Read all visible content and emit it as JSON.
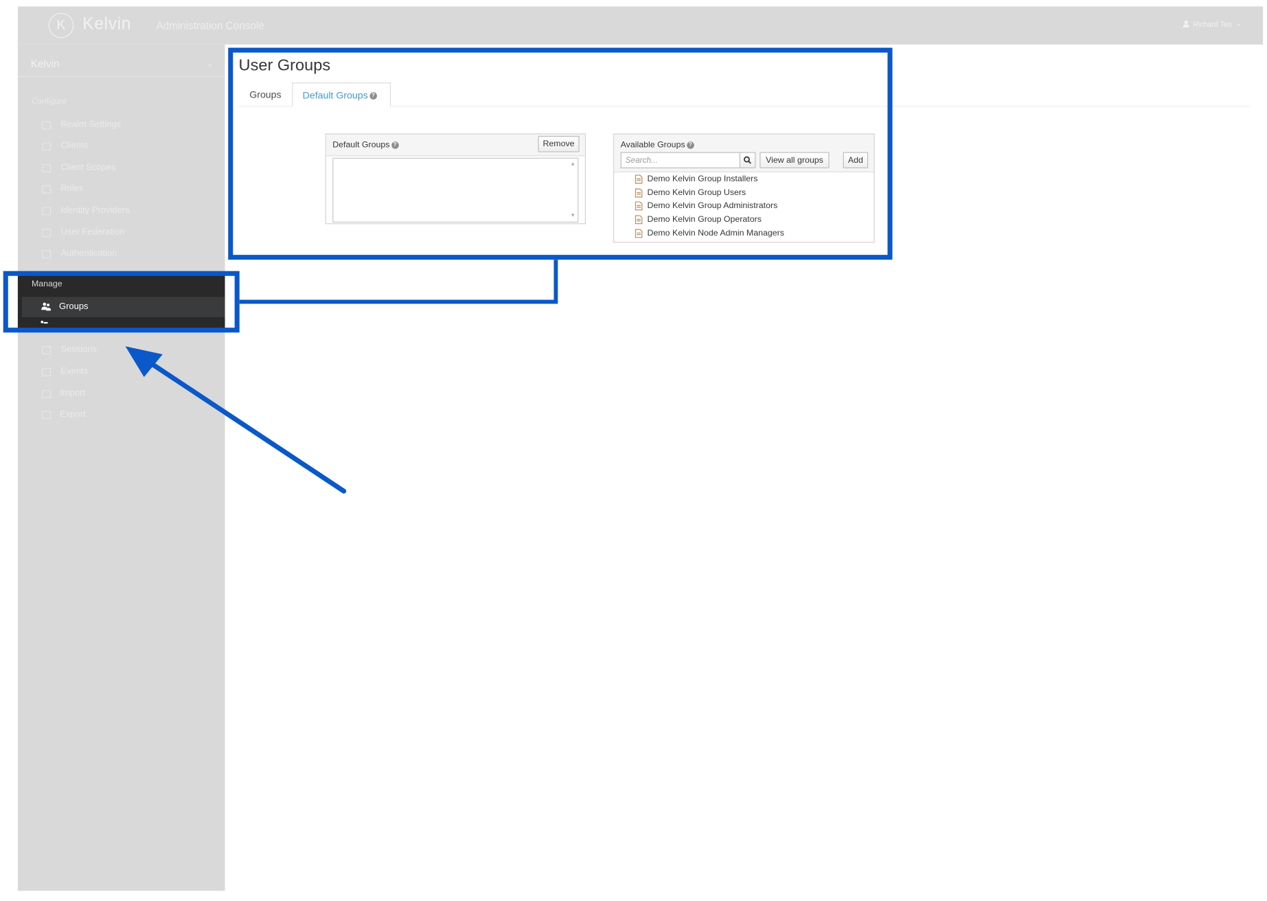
{
  "header": {
    "logo_letter": "K",
    "brand": "Kelvin",
    "console_title": "Administration Console",
    "user_name": "Richard Teo"
  },
  "sidebar": {
    "realm": "Kelvin",
    "configure_label": "Configure",
    "configure_items": [
      {
        "label": "Realm Settings"
      },
      {
        "label": "Clients"
      },
      {
        "label": "Client Scopes"
      },
      {
        "label": "Roles"
      },
      {
        "label": "Identity Providers"
      },
      {
        "label": "User Federation"
      },
      {
        "label": "Authentication"
      }
    ],
    "manage_label": "Manage",
    "active_item": "Groups",
    "manage_items": [
      {
        "label": "Sessions"
      },
      {
        "label": "Events"
      },
      {
        "label": "Import"
      },
      {
        "label": "Export"
      }
    ]
  },
  "main": {
    "title": "User Groups",
    "tabs": [
      {
        "label": "Groups"
      },
      {
        "label": "Default Groups"
      }
    ],
    "default_groups_panel": {
      "title": "Default Groups",
      "remove_label": "Remove"
    },
    "available_groups_panel": {
      "title": "Available Groups",
      "search_placeholder": "Search...",
      "view_all_label": "View all groups",
      "add_label": "Add",
      "groups": [
        "Demo Kelvin Group Installers",
        "Demo Kelvin Group Users",
        "Demo Kelvin Group Administrators",
        "Demo Kelvin Group Operators",
        "Demo Kelvin Node Admin Managers"
      ]
    }
  },
  "colors": {
    "highlight": "#0a58c9",
    "link": "#3f9ad6",
    "sidebar_bg": "#d9d9d9",
    "active_bg": "#3a3b3d"
  }
}
